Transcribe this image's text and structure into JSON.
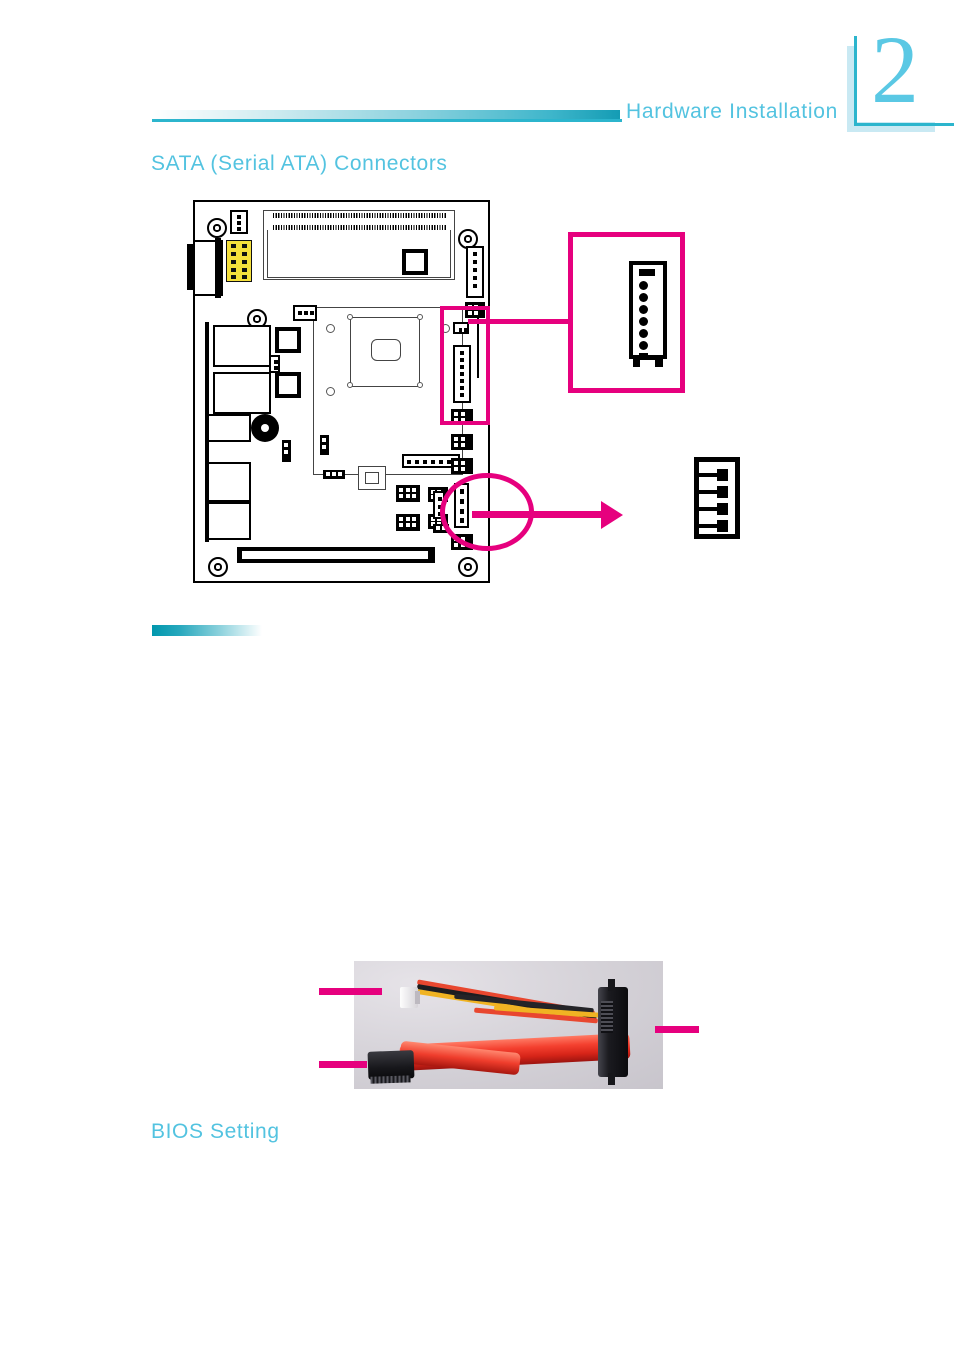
{
  "page": {
    "chapter_number": "2",
    "running_header": "Hardware Installation",
    "background_color": "#ffffff",
    "accent_color": "#53c3e0",
    "rule_color": "#2cb5cd",
    "callout_color": "#e6007e"
  },
  "sections": {
    "sata": {
      "title": "SATA (Serial ATA) Connectors"
    },
    "bios": {
      "title": "BIOS Setting"
    }
  },
  "figure_board": {
    "name": "motherboard-layout-diagram",
    "callouts": [
      {
        "id": "sata-connector-callout",
        "kind": "zoom-box",
        "pins": 7,
        "description": "SATA data connector close-up"
      },
      {
        "id": "sata-power-connector-callout",
        "kind": "arrow-zoom",
        "pins": 4,
        "description": "SATA power connector close-up"
      }
    ]
  },
  "figure_photo": {
    "name": "sata-cable-photo",
    "leaders": [
      {
        "id": "power-connector-leader",
        "position": "left-top"
      },
      {
        "id": "sata-data-connector-leader",
        "position": "left-bottom"
      },
      {
        "id": "drive-connector-leader",
        "position": "right"
      }
    ]
  },
  "icons": {
    "chapter_bracket": "corner-bracket-icon",
    "header_marker": "bar-marker-icon"
  }
}
